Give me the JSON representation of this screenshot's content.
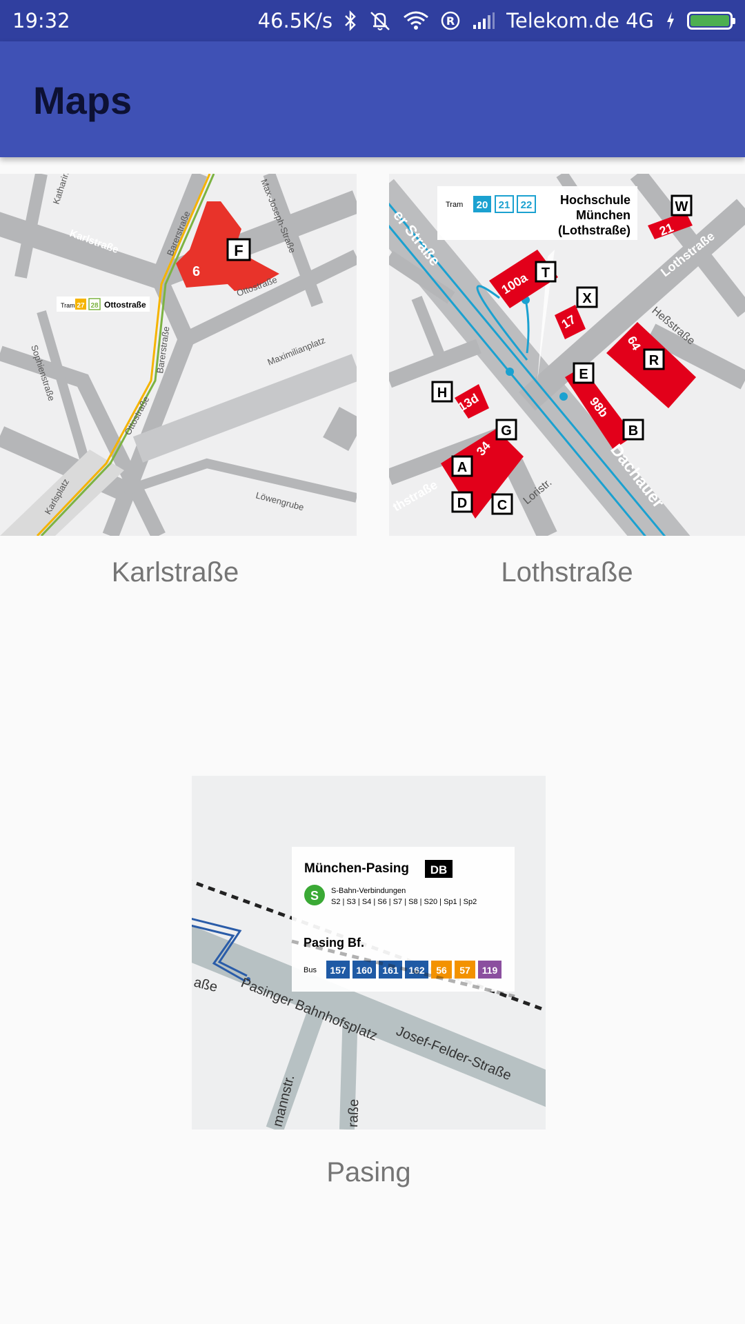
{
  "status_bar": {
    "time": "19:32",
    "net_speed": "46.5K/s",
    "carrier": "Telekom.de 4G",
    "icons": [
      "bluetooth-icon",
      "dnd-bell-icon",
      "wifi-icon",
      "roaming-r-icon",
      "signal-icon",
      "charging-icon",
      "battery-icon"
    ]
  },
  "app_bar": {
    "title": "Maps"
  },
  "maps": [
    {
      "caption": "Karlstraße",
      "labels": {
        "street1": "Karlstraße",
        "street2": "Katharin",
        "street3": "Max-Joseph-Straße",
        "street4": "Ottostraße",
        "street5": "Maximilianplatz",
        "street6": "Sophienstraße",
        "street7": "Barerstraße",
        "street8": "Ottostraße",
        "street9": "Karlsplatz",
        "street10": "Löwengrube",
        "street11": "Barerstraße",
        "tram_word": "Tram",
        "line1": "27",
        "line2": "28",
        "stop": "Ottostraße",
        "building": "6",
        "building_letter": "F"
      }
    },
    {
      "caption": "Lothstraße",
      "labels": {
        "tram_word": "Tram",
        "line1": "20",
        "line2": "21",
        "line3": "22",
        "title1": "Hochschule",
        "title2": "München",
        "title3": "(Lothstraße)",
        "street1": "er Straße",
        "street2": "Lothstraße",
        "street3": "Heßstraße",
        "street4": "Dachauer",
        "street5": "Loristr.",
        "street6": "thstraße",
        "b100a": "100a",
        "b17": "17",
        "b64": "64",
        "b98b": "98b",
        "b13d": "13d",
        "b34": "34",
        "b21": "21",
        "T": "T",
        "X": "X",
        "W": "W",
        "R": "R",
        "E": "E",
        "B": "B",
        "H": "H",
        "G": "G",
        "A": "A",
        "D": "D",
        "C": "C"
      }
    },
    {
      "caption": "Pasing",
      "labels": {
        "station": "München-Pasing",
        "db": "DB",
        "sbahn": "S-Bahn-Verbindungen",
        "sbahn_lines": "S2 | S3 | S4 | S6 | S7 | S8 | S20 | Sp1 | Sp2",
        "stop": "Pasing Bf.",
        "bus_word": "Bus",
        "bus_lines": [
          "157",
          "160",
          "161",
          "162",
          "56",
          "57",
          "119"
        ],
        "street1": "Pasinger Bahnhofsplatz",
        "street2": "Josef-Felder-Straße",
        "street3": "aße",
        "street4": "mannstr.",
        "street5": "raße"
      }
    }
  ],
  "colors": {
    "status_bar": "#303f9f",
    "app_bar": "#3f51b5",
    "campus_red": "#e2001a",
    "tram_blue": "#1ba1d0",
    "sbahn_green": "#3aa935",
    "bus_blue": "#1f5aa5",
    "bus_orange": "#f39200",
    "bus_purple": "#8b4f9f"
  }
}
